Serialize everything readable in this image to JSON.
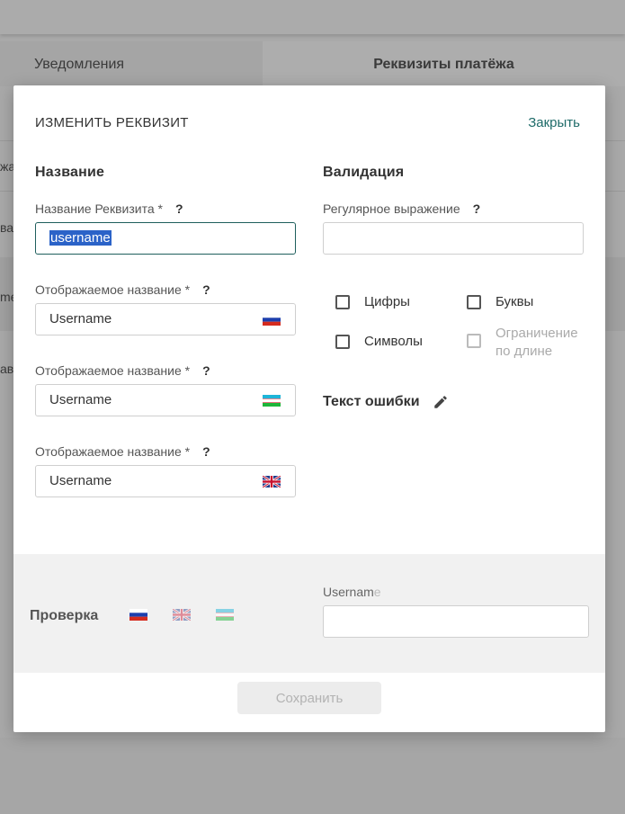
{
  "background": {
    "tabs": {
      "left": "Уведомления",
      "right": "Реквизиты платёжа"
    },
    "fragments": [
      "жа",
      "ва",
      "me",
      "ав"
    ]
  },
  "modal": {
    "title": "ИЗМЕНИТЬ РЕКВИЗИТ",
    "close": "Закрыть",
    "name_section": {
      "title": "Название",
      "requisite_name_label": "Название Реквизита *",
      "requisite_name_value": "username",
      "help": "?",
      "display_name_label": "Отображаемое название *",
      "display_names": [
        {
          "lang": "ru",
          "value": "Username"
        },
        {
          "lang": "uz",
          "value": "Username"
        },
        {
          "lang": "en",
          "value": "Username"
        }
      ]
    },
    "validation_section": {
      "title": "Валидация",
      "regex_label": "Регулярное выражение",
      "regex_value": "",
      "help": "?",
      "checkboxes": {
        "digits": "Цифры",
        "letters": "Буквы",
        "symbols": "Символы",
        "length_limit_line1": "Ограничение",
        "length_limit_line2": "по длине"
      },
      "error_text_label": "Текст ошибки"
    },
    "check_panel": {
      "label": "Проверка",
      "field_label_main": "Usernam",
      "field_label_fade": "e",
      "value": ""
    },
    "save_label": "Сохранить"
  },
  "colors": {
    "accent": "#1e6b69",
    "overlay": "#a9a9a9",
    "selection": "#2b63c8"
  }
}
